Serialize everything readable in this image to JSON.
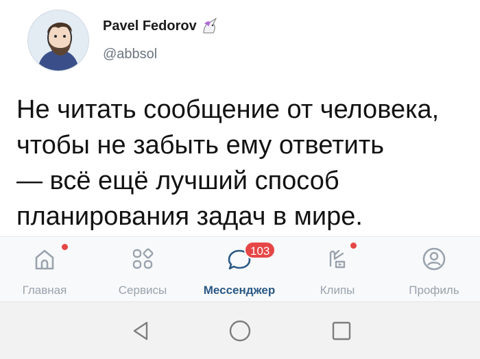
{
  "author": {
    "name": "Pavel Fedorov",
    "handle": "@abbsol",
    "avatar_icon": "avatar-illustration-icon",
    "badge_icon": "unicorn-emoji-icon"
  },
  "tweet": {
    "text": "Не читать сообщение от человека,\nчтобы не забыть ему ответить\n— всё ещё лучший способ\nпланирования задач в мире."
  },
  "tabbar": {
    "items": [
      {
        "label": "Главная",
        "icon": "home-icon",
        "has_dot": true
      },
      {
        "label": "Сервисы",
        "icon": "services-icon"
      },
      {
        "label": "Мессенджер",
        "icon": "messenger-icon",
        "badge": "103",
        "active": true
      },
      {
        "label": "Клипы",
        "icon": "clips-icon",
        "has_dot": true
      },
      {
        "label": "Профиль",
        "icon": "profile-icon"
      }
    ]
  },
  "navbar": {
    "buttons": [
      "back-triangle-icon",
      "home-circle-icon",
      "recents-square-icon"
    ]
  },
  "colors": {
    "accent": "#2a5885",
    "notification": "#e64646",
    "inactive_icon": "#99a2ad"
  }
}
